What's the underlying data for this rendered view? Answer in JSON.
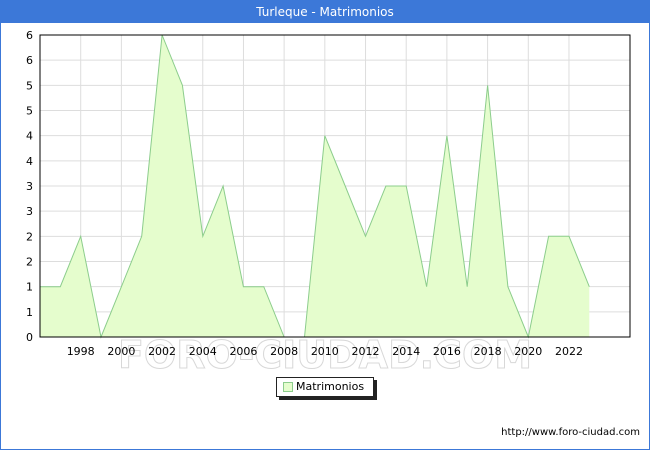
{
  "chart_data": {
    "type": "area",
    "title": "Turleque - Matrimonios",
    "watermark": "FORO-CIUDAD.COM",
    "source": "http://www.foro-ciudad.com",
    "x": [
      1996,
      1997,
      1998,
      1999,
      2000,
      2001,
      2002,
      2003,
      2004,
      2005,
      2006,
      2007,
      2008,
      2009,
      2010,
      2011,
      2012,
      2013,
      2014,
      2015,
      2016,
      2017,
      2018,
      2019,
      2020,
      2021,
      2022,
      2023
    ],
    "series": [
      {
        "name": "Matrimonios",
        "values": [
          1,
          1,
          2,
          0,
          1,
          2,
          6,
          5,
          2,
          3,
          1,
          1,
          0,
          0,
          4,
          3,
          2,
          3,
          3,
          1,
          4,
          1,
          5,
          1,
          0,
          2,
          2,
          1
        ]
      }
    ],
    "x_ticks": [
      "1998",
      "2000",
      "2002",
      "2004",
      "2006",
      "2008",
      "2010",
      "2012",
      "2014",
      "2016",
      "2018",
      "2020",
      "2022"
    ],
    "y_tick_labels": [
      "0",
      "1",
      "1",
      "2",
      "2",
      "3",
      "3",
      "4",
      "4",
      "5",
      "5",
      "6",
      "6"
    ],
    "ylim": [
      0,
      6
    ],
    "xlim": [
      1996,
      2025
    ],
    "xlabel": "",
    "ylabel": "",
    "grid": true,
    "legend_position": "bottom-center",
    "colors": {
      "fill": "#e5fdcd",
      "line": "#8ccd8c",
      "header": "#3c78d8",
      "grid": "#dddddd"
    }
  }
}
